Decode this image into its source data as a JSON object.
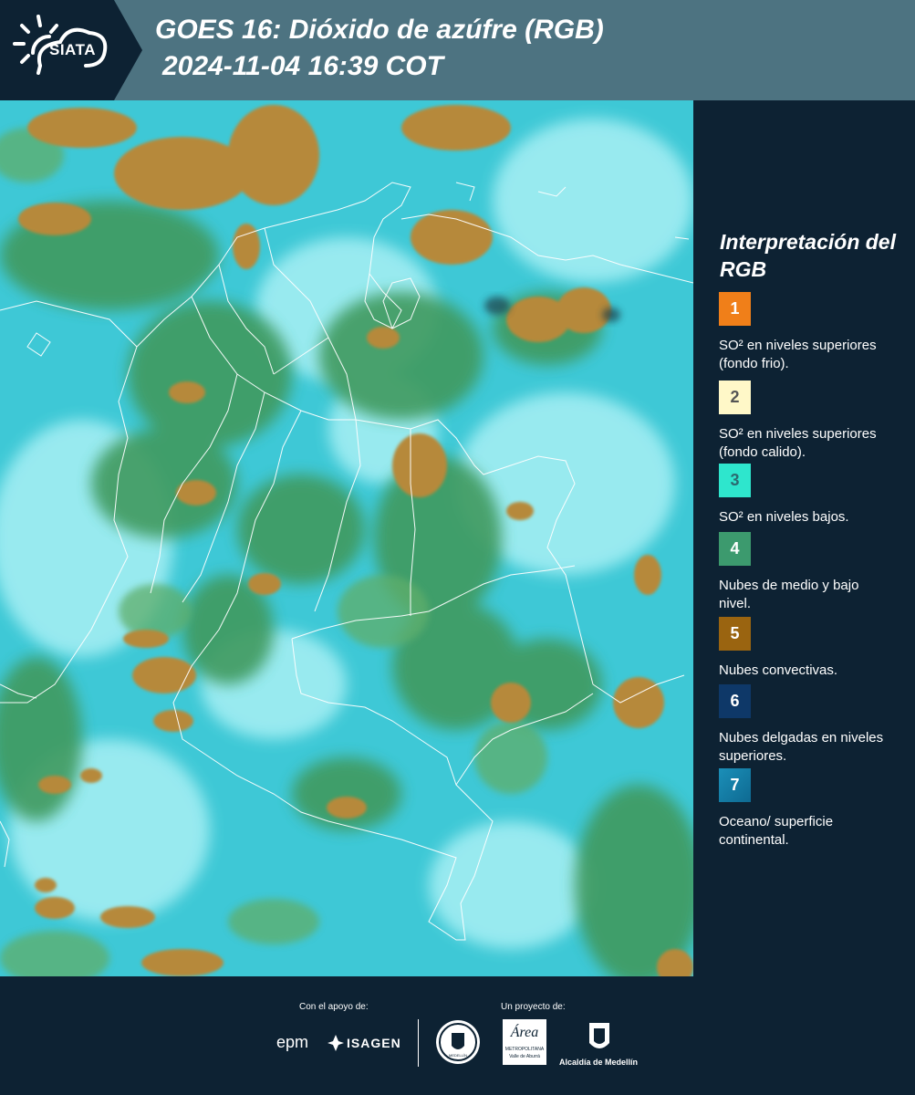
{
  "header": {
    "logo_text": "SIATA",
    "title": "GOES 16: Dióxido de azúfre (RGB)",
    "subtitle": " 2024-11-04 16:39 COT"
  },
  "legend": {
    "title": "Interpretación del RGB",
    "items": [
      {
        "number": "1",
        "label": "SO² en niveles superiores (fondo frio).",
        "color": "#f07f19",
        "text_color": "#ffffff"
      },
      {
        "number": "2",
        "label": "SO² en niveles superiores (fondo calido).",
        "color": "#fff8c8",
        "text_color": "#555555"
      },
      {
        "number": "3",
        "label": "SO² en niveles bajos.",
        "color": "#2ee6cd",
        "text_color": "#2b6b70"
      },
      {
        "number": "4",
        "label": "Nubes de medio y bajo nivel.",
        "color": "#3c9a6e",
        "text_color": "#ffffff"
      },
      {
        "number": "5",
        "label": "Nubes convectivas.",
        "color": "#9a6410",
        "text_color": "#ffffff"
      },
      {
        "number": "6",
        "label": "Nubes delgadas en niveles superiores.",
        "color": "#0e3868",
        "text_color": "#ffffff"
      },
      {
        "number": "7",
        "label": "Oceano/ superficie continental.",
        "color": "#1b8fb8",
        "text_color": "#ffffff"
      }
    ]
  },
  "footer": {
    "support_label": "Con el apoyo de:",
    "project_label": "Un proyecto de:",
    "sponsor_1": "epm",
    "sponsor_2": "ISAGEN",
    "partner_1": "MEDELLÍN",
    "partner_2": "Área",
    "partner_2_sub": "METROPOLITANA",
    "partner_2_sub2": "Valle de Aburrá",
    "partner_3": "Alcaldía de Medellín"
  }
}
